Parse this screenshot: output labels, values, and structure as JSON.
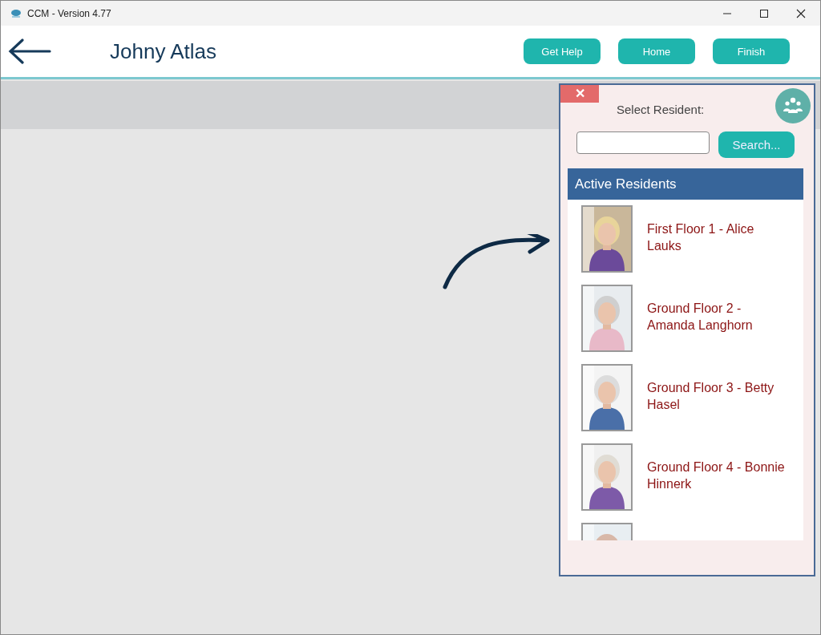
{
  "window": {
    "title": "CCM - Version 4.77"
  },
  "header": {
    "name": "Johny Atlas",
    "buttons": [
      "Get Help",
      "Home",
      "Finish"
    ]
  },
  "panel": {
    "close": "✕",
    "label": "Select Resident:",
    "search": {
      "button": "Search..."
    },
    "list_title": "Active Residents",
    "residents": [
      {
        "kind": "picture",
        "name": "First Floor 1 - Alice Lauks"
      },
      {
        "kind": "picture",
        "name": "Ground Floor 2 - Amanda Langhorn"
      },
      {
        "kind": "picture",
        "name": "Ground Floor 3 - Betty Hasel"
      },
      {
        "kind": "picture",
        "name": "Ground Floor 4 - Bonnie Hinnerk"
      },
      {
        "kind": "picture"
      }
    ]
  }
}
